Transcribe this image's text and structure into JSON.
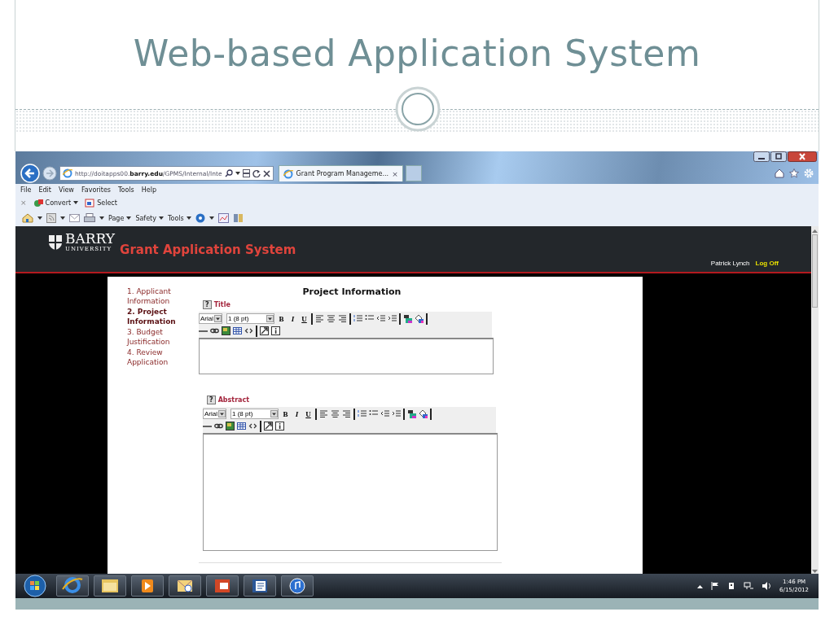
{
  "slide": {
    "title": "Web‑based Application System"
  },
  "browser": {
    "address": "http://doitapps00.**barry.edu**/GPMS/Internal/Inte",
    "tabs": [
      {
        "label": "Grant Program Manageme...",
        "close": "×",
        "selected": true
      }
    ],
    "menu": [
      "File",
      "Edit",
      "View",
      "Favorites",
      "Tools",
      "Help"
    ],
    "favorites_bar": {
      "close": "×",
      "items": [
        {
          "label": "Convert",
          "kind": "dropdown"
        },
        {
          "label": "Select",
          "kind": "plain"
        }
      ]
    },
    "command_bar": [
      {
        "label": "Page"
      },
      {
        "label": "Safety"
      },
      {
        "label": "Tools"
      }
    ]
  },
  "app": {
    "logo": {
      "name": "BARRY",
      "sub": "UNIVERSITY"
    },
    "title": "Grant Application System",
    "user": "Patrick Lynch",
    "logoff": "Log Off",
    "steps": [
      {
        "label": "1. Applicant Information",
        "selected": false
      },
      {
        "label": "2. Project Information",
        "selected": true
      },
      {
        "label": "3. Budget Justification",
        "selected": false
      },
      {
        "label": "4. Review Application",
        "selected": false
      }
    ],
    "heading": "Project Information",
    "fields": [
      {
        "help": "?",
        "label": "Title",
        "kind": "short",
        "font": "Arial",
        "size": "1 (8 pt)",
        "format_buttons": [
          "B",
          "I",
          "U"
        ]
      },
      {
        "help": "?",
        "label": "Abstract",
        "kind": "long",
        "font": "Arial",
        "size": "1 (8 pt)",
        "format_buttons": [
          "B",
          "I",
          "U"
        ]
      }
    ]
  },
  "taskbar": {
    "time": "1:46 PM",
    "date": "6/15/2012"
  }
}
